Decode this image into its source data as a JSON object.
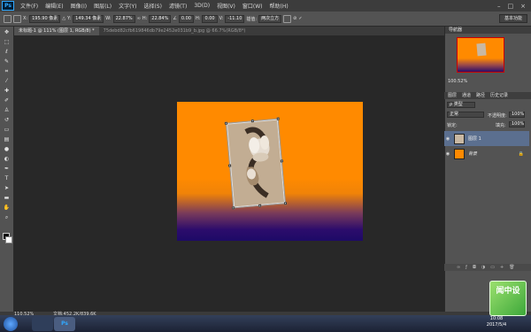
{
  "menubar": {
    "logo": "Ps",
    "items": [
      "文件(F)",
      "编辑(E)",
      "图像(I)",
      "图层(L)",
      "文字(Y)",
      "选择(S)",
      "滤镜(T)",
      "3D(D)",
      "视图(V)",
      "窗口(W)",
      "帮助(H)"
    ],
    "controls": [
      "–",
      "□",
      "×"
    ]
  },
  "options": {
    "x_label": "X:",
    "x_value": "195.90 像素",
    "y_label": "Y:",
    "y_value": "149.34 像素",
    "w_label": "W:",
    "w_value": "22.87%",
    "h_label": "H:",
    "h_value": "22.84%",
    "angle_value": "0.00",
    "h_skew_label": "H:",
    "h_skew_value": "0.00",
    "v_skew_label": "V:",
    "v_skew_value": "-11.10",
    "interp_label": "插值:",
    "interp_value": "两次立方",
    "workspace": "基本功能"
  },
  "tabs": [
    {
      "label": "未标题-1 @ 111% (图层 1, RGB/8) *",
      "active": true
    },
    {
      "label": "75debd82cfb619846db79e2452e031b9_b.jpg @ 66.7%(RGB/8*)",
      "active": false
    }
  ],
  "navigator": {
    "title": "导航器",
    "zoom": "100.52%"
  },
  "layers_panel": {
    "tabs": [
      "图层",
      "通道",
      "路径",
      "历史记录"
    ],
    "kind": "ρ 类型",
    "blend": "正常",
    "opacity_label": "不透明度:",
    "opacity": "100%",
    "lock_label": "锁定:",
    "fill_label": "填充:",
    "fill": "100%",
    "layers": [
      {
        "name": "图层 1",
        "selected": true
      },
      {
        "name": "背景",
        "selected": false
      }
    ]
  },
  "status": {
    "zoom": "110.52%",
    "doc": "文档:452.2K/839.6K"
  },
  "taskbar": {
    "time": "10:08",
    "date": "2017/5/4",
    "ps_label": "Ps"
  },
  "watermark": {
    "text": "闻中设"
  },
  "colors": {
    "canvas_top": "#ff8a00",
    "canvas_bottom": "#1d0a66",
    "accent": "#31a8ff"
  }
}
